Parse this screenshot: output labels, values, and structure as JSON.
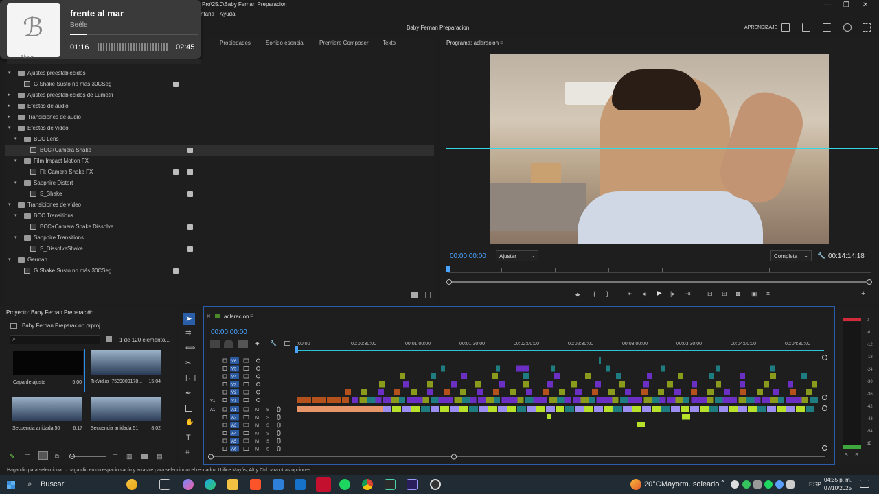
{
  "window": {
    "title": "Baby Fernan Preparacion",
    "path_text": "Pro\\25.0\\Baby Fernan Preparacion",
    "menu_items": [
      "ntana",
      "Ayuda"
    ],
    "aprendizaje": "APRENDIZAJE"
  },
  "notification": {
    "song": "frente al mar",
    "artist": "Beéle",
    "elapsed": "01:16",
    "duration": "02:45",
    "search_placeholder": "Share"
  },
  "effects_panel": {
    "tabs": [
      "Propiedades",
      "Sonido esencial",
      "Premiere Composer",
      "Texto"
    ],
    "rows": [
      {
        "label": "Ajustes preestablecidos",
        "indent": 0,
        "expanded": true,
        "type": "folder",
        "badges": 0
      },
      {
        "label": "G Shake Susto no más 30CSeg",
        "indent": 1,
        "expanded": null,
        "type": "fx",
        "badges": 1
      },
      {
        "label": "Ajustes preestablecidos de Lumetri",
        "indent": 0,
        "expanded": false,
        "type": "folder",
        "badges": 0
      },
      {
        "label": "Efectos de audio",
        "indent": 0,
        "expanded": false,
        "type": "folder",
        "badges": 0
      },
      {
        "label": "Transiciones de audio",
        "indent": 0,
        "expanded": false,
        "type": "folder",
        "badges": 0
      },
      {
        "label": "Efectos de vídeo",
        "indent": 0,
        "expanded": true,
        "type": "folder",
        "badges": 0
      },
      {
        "label": "BCC Lens",
        "indent": 1,
        "expanded": true,
        "type": "folder",
        "badges": 0
      },
      {
        "label": "BCC+Camera Shake",
        "indent": 2,
        "expanded": null,
        "type": "fx",
        "badges": 2,
        "selected": true
      },
      {
        "label": "Film Impact Motion FX",
        "indent": 1,
        "expanded": true,
        "type": "folder",
        "badges": 0
      },
      {
        "label": "FI: Camera Shake FX",
        "indent": 2,
        "expanded": null,
        "type": "fx",
        "badges": 3
      },
      {
        "label": "Sapphire Distort",
        "indent": 1,
        "expanded": true,
        "type": "folder",
        "badges": 0
      },
      {
        "label": "S_Shake",
        "indent": 2,
        "expanded": null,
        "type": "fx",
        "badges": 2
      },
      {
        "label": "Transiciones de vídeo",
        "indent": 0,
        "expanded": true,
        "type": "folder",
        "badges": 0
      },
      {
        "label": "BCC Transitions",
        "indent": 1,
        "expanded": true,
        "type": "folder",
        "badges": 0
      },
      {
        "label": "BCC+Camera Shake Dissolve",
        "indent": 2,
        "expanded": null,
        "type": "fx",
        "badges": 2
      },
      {
        "label": "Sapphire Transitions",
        "indent": 1,
        "expanded": true,
        "type": "folder",
        "badges": 0
      },
      {
        "label": "S_DissolveShake",
        "indent": 2,
        "expanded": null,
        "type": "fx",
        "badges": 2
      },
      {
        "label": "German",
        "indent": 0,
        "expanded": true,
        "type": "folder",
        "badges": 0
      },
      {
        "label": "G Shake Susto no más 30CSeg",
        "indent": 1,
        "expanded": null,
        "type": "fx",
        "badges": 1
      }
    ]
  },
  "program_monitor": {
    "title": "Programa: aclaracion",
    "timecode": "00:00:00:00",
    "fit": "Ajustar",
    "quality": "Completa",
    "duration": "00:14:14:18"
  },
  "project_panel": {
    "title": "Proyecto: Baby Fernan Preparacion",
    "file": "Baby Fernan Preparacion.prproj",
    "count": "1 de 120 elemento...",
    "items": [
      {
        "name": "Capa de ajuste",
        "duration": "5:00",
        "thumb": "black"
      },
      {
        "name": "TikVid.io_7539009178...",
        "duration": "15:04",
        "thumb": "photo"
      },
      {
        "name": "Secuencia anidada 50",
        "duration": "6:17",
        "thumb": "photo"
      },
      {
        "name": "Secuencia anidada 51",
        "duration": "8:02",
        "thumb": "photo"
      }
    ]
  },
  "timeline": {
    "sequence": "aclaracion",
    "timecode": "00:00:00:00",
    "ruler": [
      ":00:00",
      "00:00:30:00",
      "00:01:00:00",
      "00:01:30:00",
      "00:02:00:00",
      "00:02:30:00",
      "00:03:00:00",
      "00:03:30:00",
      "00:04:00:00",
      "00:04:30:00"
    ],
    "video_tracks": [
      "V6",
      "V5",
      "V4",
      "V3",
      "V2",
      "V1"
    ],
    "audio_tracks": [
      "A1",
      "A2",
      "A3",
      "A4",
      "A5",
      "A6"
    ],
    "source_patch_video": "V1",
    "source_patch_audio": "A1",
    "audio_toggles": [
      "M",
      "S"
    ]
  },
  "meters": {
    "scale": [
      "0",
      "-6",
      "-12",
      "-18",
      "-24",
      "-30",
      "-36",
      "-42",
      "-48",
      "-54",
      "dB"
    ],
    "solo": [
      "S",
      "S"
    ]
  },
  "status_text": "Haga clic para seleccionar o haga clic en un espacio vacío y arrastre para seleccionar el recuadro. Utilice Mayús, Alt y Ctrl para otras opciones.",
  "taskbar": {
    "search": "Buscar",
    "weather_temp": "20°C",
    "weather_desc": "Mayorm. soleado",
    "lang": "ESP",
    "time": "04:35 p. m.",
    "date": "07/10/2025"
  },
  "colors": {
    "accent_blue": "#2d8ceb",
    "timecode_blue": "#4aa3ff",
    "clip_purple": "#6b2fc4",
    "clip_olive": "#8a9a1c",
    "clip_orange": "#b5511c",
    "clip_teal": "#1f7c80",
    "audio_lavender": "#9c8ef0",
    "audio_lime": "#b6e02a"
  }
}
